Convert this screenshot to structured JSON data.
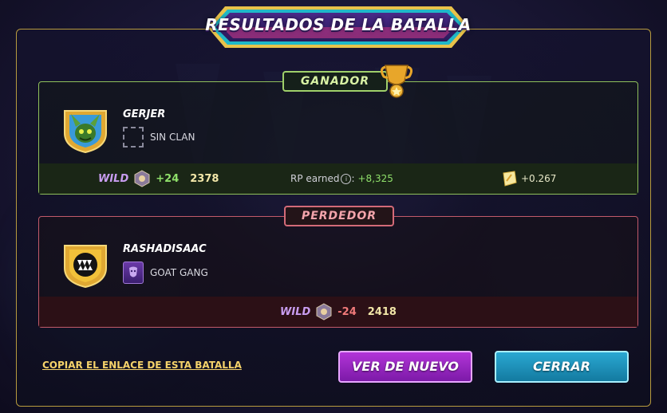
{
  "title": "RESULTADOS DE LA BATALLA",
  "winner": {
    "tag": "GANADOR",
    "name": "GERJER",
    "clan": "SIN CLAN",
    "league": "WILD",
    "rating_change": "+24",
    "rating": "2378",
    "rp_label": "RP earned",
    "rp_value": "+8,325",
    "sps_value": "+0.267"
  },
  "loser": {
    "tag": "PERDEDOR",
    "name": "RASHADISAAC",
    "clan": "GOAT GANG",
    "league": "WILD",
    "rating_change": "-24",
    "rating": "2418"
  },
  "actions": {
    "copy_link": "COPIAR EL ENLACE DE ESTA BATALLA",
    "replay": "VER DE NUEVO",
    "close": "CERRAR"
  },
  "colors": {
    "winner_accent": "#8fc05a",
    "loser_accent": "#c25a6a",
    "gold_border": "#b89b3e",
    "replay_button": "#9b27c4",
    "close_button": "#1f93bb"
  },
  "icons": {
    "trophy": "trophy-icon",
    "league": "wild-league-icon",
    "sps": "sps-token-icon",
    "info": "info-icon"
  }
}
